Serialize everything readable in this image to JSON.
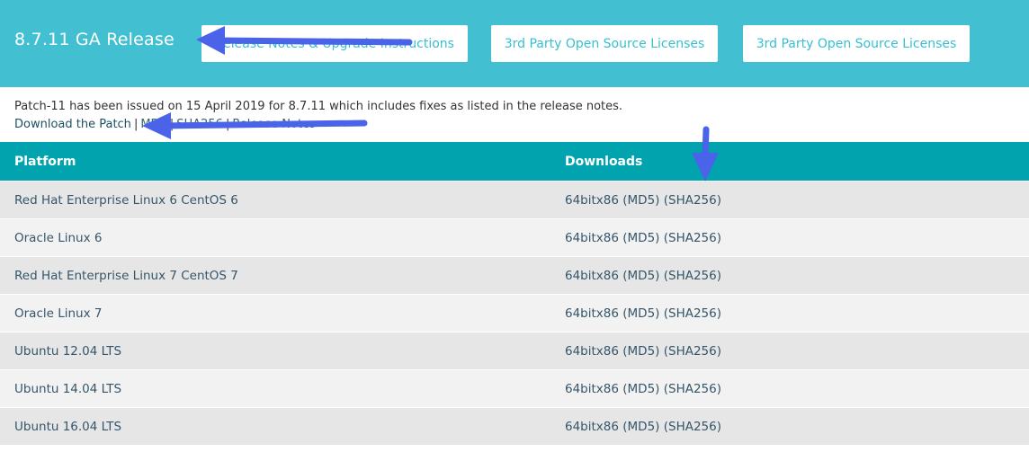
{
  "header": {
    "title": "8.7.11 GA Release",
    "buttons": [
      {
        "label": "Release Notes & Upgrade Instructions"
      },
      {
        "label": "3rd Party Open Source Licenses"
      },
      {
        "label": "3rd Party Open Source Licenses"
      }
    ]
  },
  "info": {
    "text": "Patch-11 has been issued on 15 April 2019 for 8.7.11 which includes fixes as listed in the release notes.",
    "links": [
      "Download the Patch",
      "MD5",
      "SHA256",
      "Release Notes"
    ],
    "separator": "|"
  },
  "table": {
    "headers": {
      "platform": "Platform",
      "downloads": "Downloads"
    },
    "rows": [
      {
        "platform": "Red Hat Enterprise Linux 6 CentOS 6",
        "arch": "64bitx86",
        "md5": "(MD5)",
        "sha": "(SHA256)"
      },
      {
        "platform": "Oracle Linux 6",
        "arch": "64bitx86",
        "md5": "(MD5)",
        "sha": "(SHA256)"
      },
      {
        "platform": "Red Hat Enterprise Linux 7 CentOS 7",
        "arch": "64bitx86",
        "md5": "(MD5)",
        "sha": "(SHA256)"
      },
      {
        "platform": "Oracle Linux 7",
        "arch": "64bitx86",
        "md5": "(MD5)",
        "sha": "(SHA256)"
      },
      {
        "platform": "Ubuntu 12.04 LTS",
        "arch": "64bitx86",
        "md5": "(MD5)",
        "sha": "(SHA256)"
      },
      {
        "platform": "Ubuntu 14.04 LTS",
        "arch": "64bitx86",
        "md5": "(MD5)",
        "sha": "(SHA256)"
      },
      {
        "platform": "Ubuntu 16.04 LTS",
        "arch": "64bitx86",
        "md5": "(MD5)",
        "sha": "(SHA256)"
      }
    ]
  },
  "colors": {
    "header_bg": "#42c0d2",
    "table_header_bg": "#00a3ae",
    "arrow": "#4a63e8",
    "link": "#1f4f63"
  }
}
